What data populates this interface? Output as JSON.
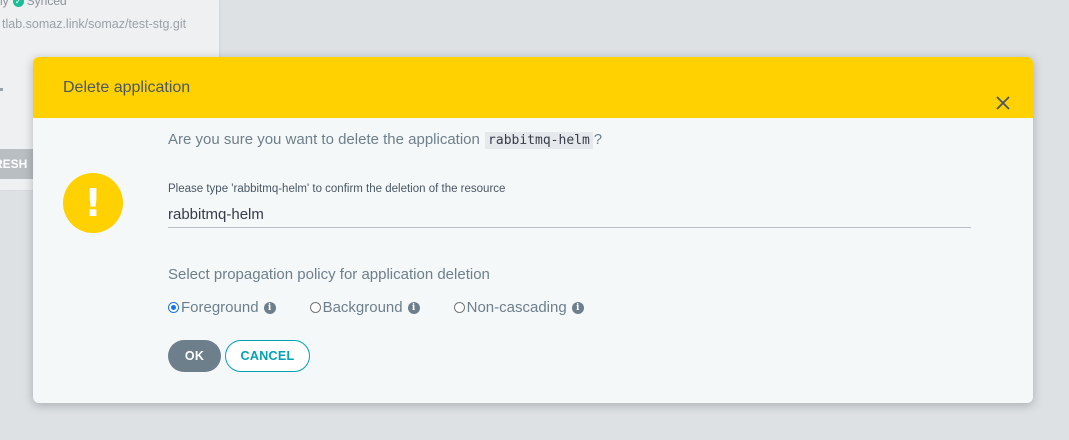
{
  "background_app": {
    "status_prefix": "ly",
    "status_text": "Synced",
    "repo_url": "tlab.somaz.link/somaz/test-stg.git",
    "refresh_label": "RESH"
  },
  "dialog": {
    "title": "Delete application",
    "question_prefix": "Are you sure you want to delete the application",
    "app_name": "rabbitmq-helm",
    "question_suffix": "?",
    "confirm_label": "Please type 'rabbitmq-helm' to confirm the deletion of the resource",
    "confirm_value": "rabbitmq-helm",
    "policy_label": "Select propagation policy for application deletion",
    "policies": [
      {
        "label": "Foreground",
        "checked": true
      },
      {
        "label": "Background",
        "checked": false
      },
      {
        "label": "Non-cascading",
        "checked": false
      }
    ],
    "ok_label": "OK",
    "cancel_label": "CANCEL",
    "warning_glyph": "!",
    "info_glyph": "i"
  },
  "colors": {
    "header": "#ffd100",
    "accent": "#00a2b3",
    "ok_button": "#6d7f8b"
  },
  "icons": {
    "close": "close-icon",
    "warning": "warning-icon",
    "info": "info-icon",
    "synced": "check-circle-icon"
  }
}
